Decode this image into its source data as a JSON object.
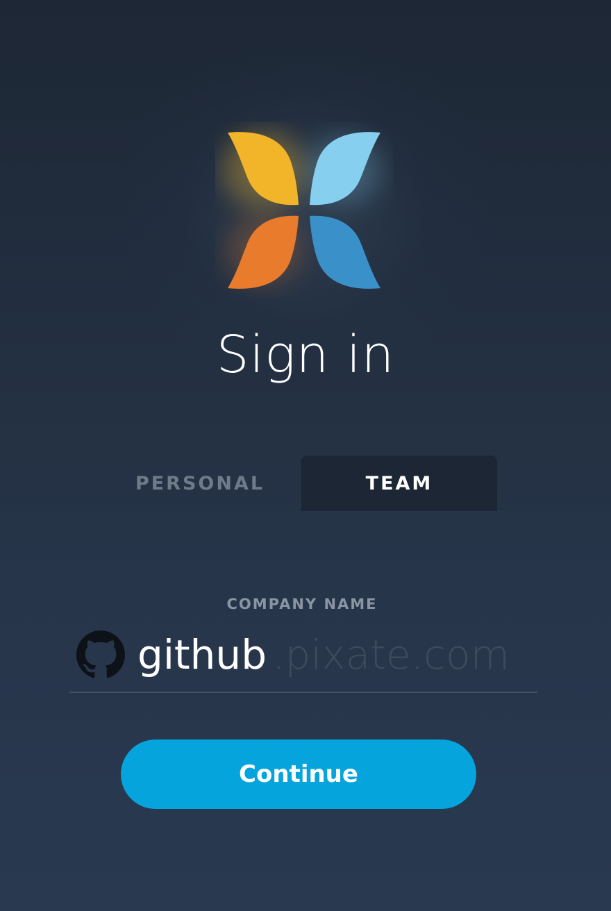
{
  "header": {
    "title": "Sign in",
    "logo_icon": "pixate-logo-icon"
  },
  "tabs": [
    {
      "label": "PERSONAL",
      "selected": false
    },
    {
      "label": "TEAM",
      "selected": true
    }
  ],
  "form": {
    "field_label": "COMPANY NAME",
    "field_icon": "github-icon",
    "company_value": "github",
    "domain_suffix": ".pixate.com"
  },
  "actions": {
    "continue_label": "Continue"
  },
  "colors": {
    "accent": "#05a4dd",
    "logo_yellow": "#f2b52a",
    "logo_orange": "#e97b2c",
    "logo_light_blue": "#86cfee",
    "logo_blue": "#3a91c9"
  }
}
